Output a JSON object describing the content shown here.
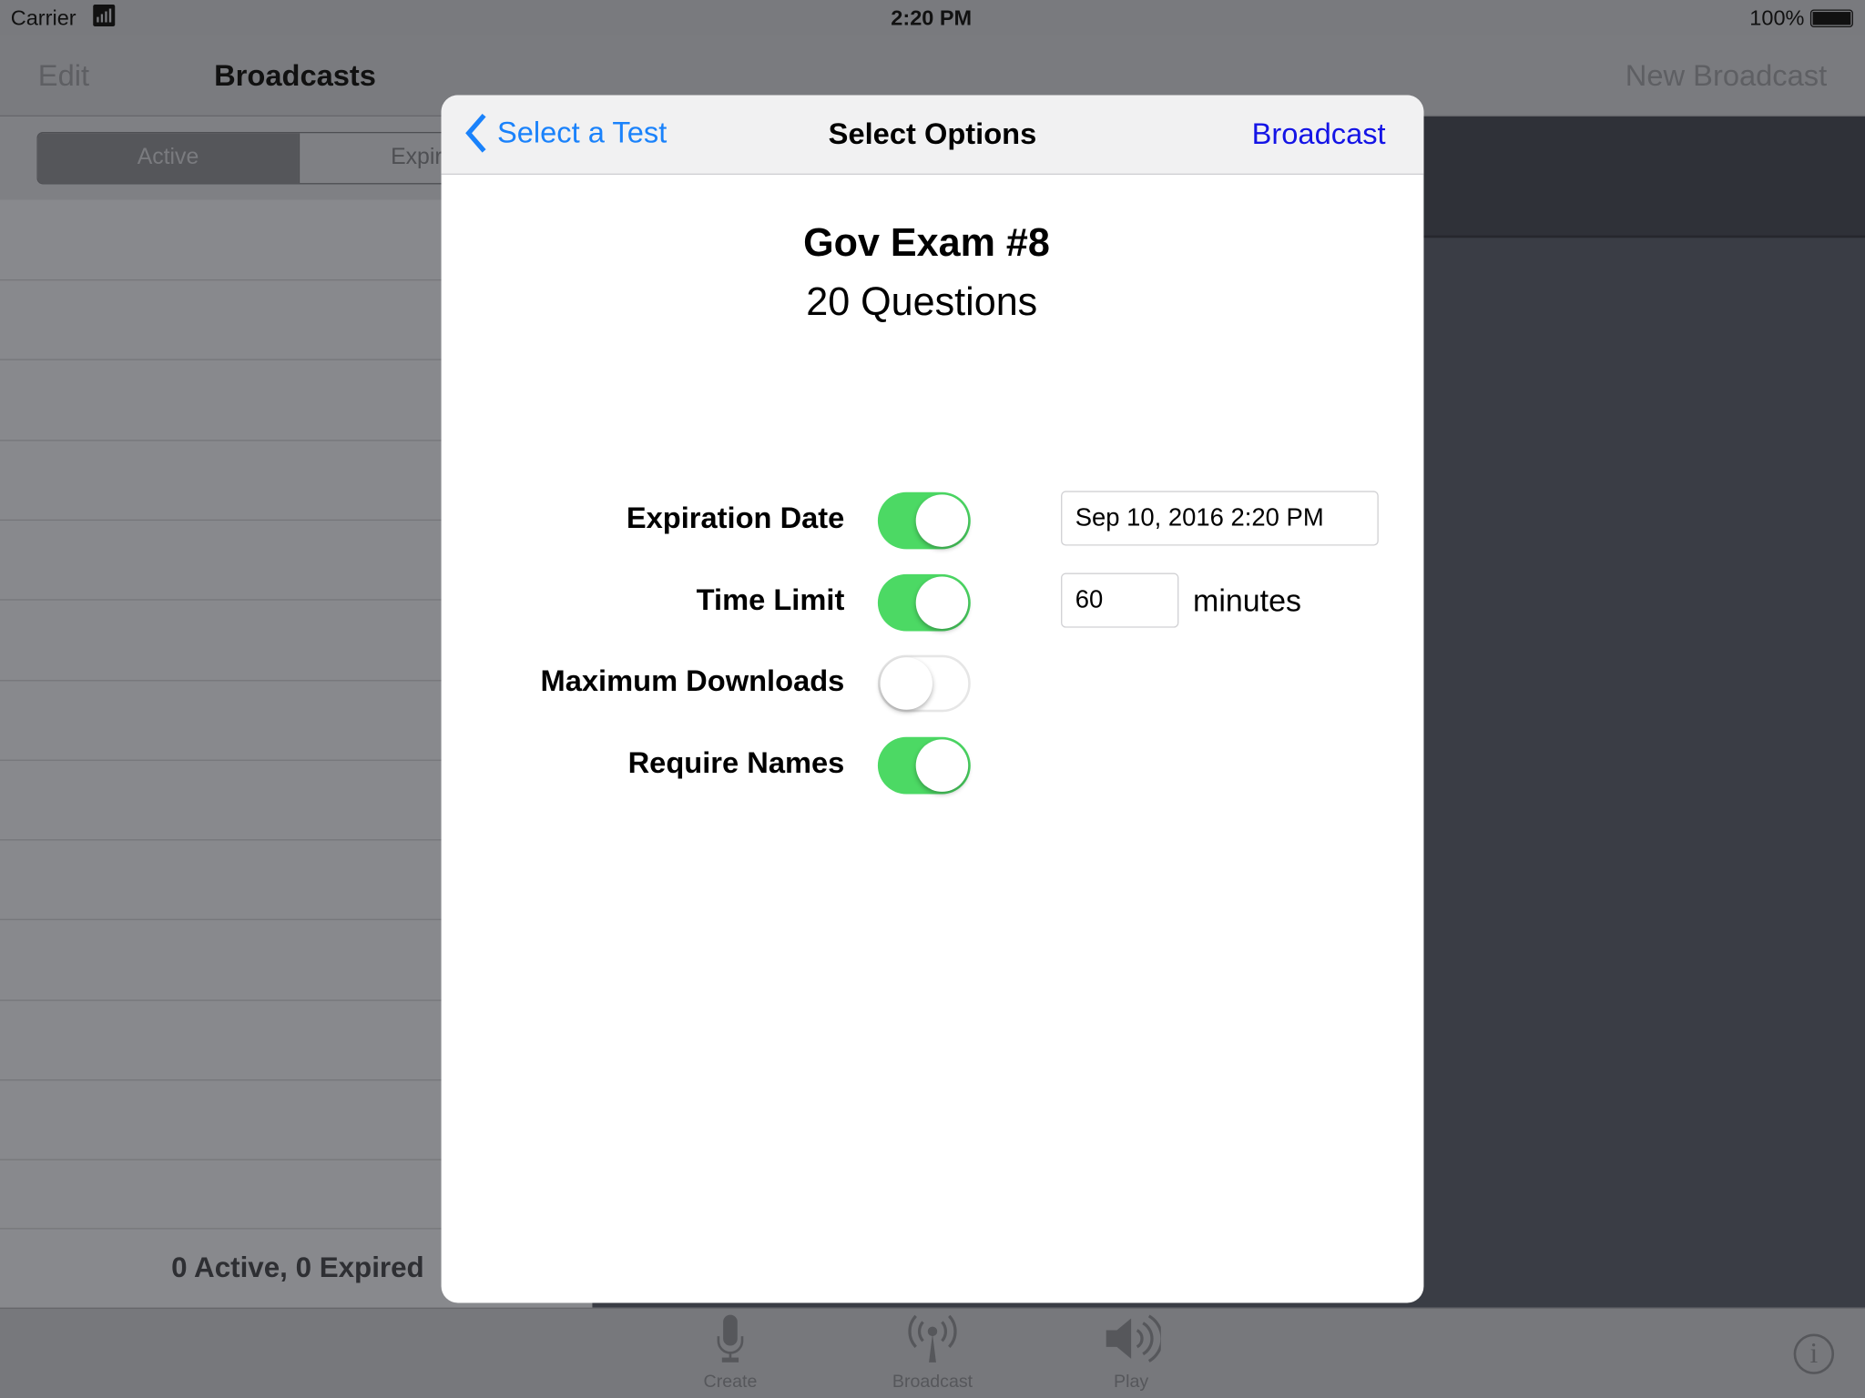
{
  "status_bar": {
    "carrier": "Carrier",
    "time": "2:20 PM",
    "battery": "100%"
  },
  "nav": {
    "edit": "Edit",
    "title": "Broadcasts",
    "new_broadcast": "New Broadcast"
  },
  "segments": {
    "active": "Active",
    "expired": "Expired"
  },
  "footer": {
    "summary": "0 Active, 0 Expired"
  },
  "tabs": [
    {
      "label": "Create",
      "icon": "microphone-icon"
    },
    {
      "label": "Broadcast",
      "icon": "antenna-icon"
    },
    {
      "label": "Play",
      "icon": "speaker-icon"
    }
  ],
  "modal": {
    "back": "Select a Test",
    "title": "Select Options",
    "action": "Broadcast",
    "exam_name": "Gov Exam #8",
    "question_count": "20 Questions",
    "options": [
      {
        "label": "Expiration Date",
        "on": true
      },
      {
        "label": "Time Limit",
        "on": true
      },
      {
        "label": "Maximum Downloads",
        "on": false
      },
      {
        "label": "Require Names",
        "on": true
      }
    ],
    "expiration_value": "Sep 10, 2016 2:20 PM",
    "time_limit_value": "60",
    "time_limit_unit": "minutes"
  },
  "colors": {
    "accent": "#1a82fb",
    "broadcast_link": "#1414e6",
    "switch_on": "#4cd964"
  }
}
